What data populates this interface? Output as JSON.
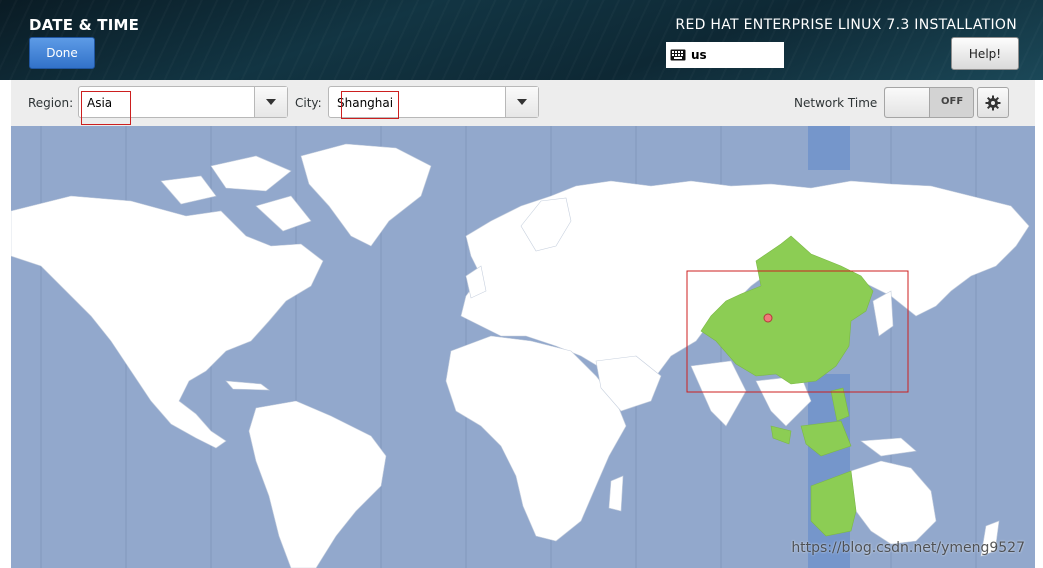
{
  "header": {
    "page_title": "DATE & TIME",
    "done_label": "Done",
    "product_title": "RED HAT ENTERPRISE LINUX 7.3 INSTALLATION",
    "keyboard_layout": "us",
    "help_label": "Help!"
  },
  "toolbar": {
    "region_label": "Region:",
    "region_value": "Asia",
    "city_label": "City:",
    "city_value": "Shanghai",
    "network_time_label": "Network Time",
    "network_time_state": "OFF"
  },
  "map": {
    "ocean_color": "#92a8cc",
    "land_color": "#ffffff",
    "selected_timezone_color": "#8ccd54",
    "selected_band_color": "#7596cb",
    "marker_color": "#f07a7a"
  },
  "watermark": "https://blog.csdn.net/ymeng9527",
  "colors": {
    "accent_blue": "#3f86d8",
    "annotation_red": "#cc1f1f"
  }
}
